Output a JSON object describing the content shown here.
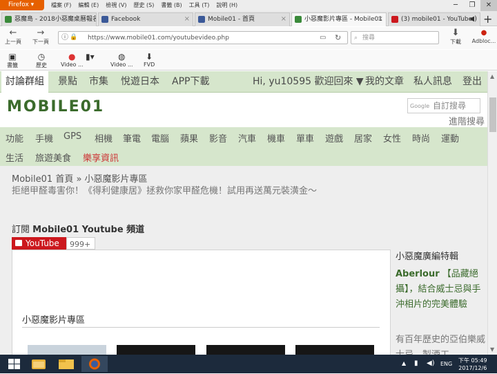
{
  "browser": {
    "app_button": "Firefox",
    "menu": [
      "檔案 (F)",
      "編輯 (E)",
      "檢視 (V)",
      "歷史 (S)",
      "書籤 (B)",
      "工具 (T)",
      "說明 (H)"
    ],
    "tabs": [
      {
        "label": "惡魔島 - 2018小惡魔桌曆報名",
        "icon_color": "#3a8a3a"
      },
      {
        "label": "Facebook",
        "icon_color": "#3b5998"
      },
      {
        "label": "Mobile01 - 首頁",
        "icon_color": "#3b5998"
      },
      {
        "label": "小惡魔影片專區 - Mobile01",
        "icon_color": "#3a8a3a"
      },
      {
        "label": "(3) mobile01 - YouTube",
        "icon_color": "#cc181e"
      }
    ],
    "nav": {
      "back": "上一頁",
      "forward": "下一頁"
    },
    "url": "https://www.mobile01.com/youtubevideo.php",
    "search_placeholder": "搜尋",
    "download_label": "下載",
    "adblock_label": "Adbloc...",
    "bookmarks": [
      {
        "label": "書籤",
        "icon": "bookmark-icon"
      },
      {
        "label": "歷史",
        "icon": "history-icon"
      },
      {
        "label": "Video ...",
        "icon": "video-icon"
      },
      {
        "label": "Video ...",
        "icon": "video-icon"
      },
      {
        "label": "FVD",
        "icon": "download-icon"
      }
    ]
  },
  "site": {
    "top_nav": [
      "討論群組",
      "景點",
      "市集",
      "悅遊日本",
      "APP下載"
    ],
    "user_greeting": "Hi, yu10595 歡迎回來 ▼",
    "user_links": [
      "我的文章",
      "私人訊息",
      "登出"
    ],
    "logo": "MOBILE01",
    "search_placeholder": "自訂搜尋",
    "search_brand": "Google",
    "advanced_search": "進階搜尋",
    "categories_row1": [
      "功能",
      "手機",
      "GPS",
      "相機",
      "筆電",
      "電腦",
      "蘋果",
      "影音",
      "汽車",
      "機車",
      "單車",
      "遊戲",
      "居家",
      "女性",
      "時尚",
      "運動"
    ],
    "categories_row2": [
      "生活",
      "旅遊美食",
      "樂享資訊"
    ],
    "breadcrumb": "Mobile01 首頁 » 小惡魔影片專區",
    "promo": "拒絕甲醛毒害你！《得利健康居》拯救你家甲醛危機！試用再送萬元裝潢金～",
    "subscribe_prefix": "訂閱 ",
    "subscribe_bold": "Mobile01 Youtube 頻道",
    "youtube_label": "YouTube",
    "youtube_count": "999+",
    "video_section_title": "小惡魔影片專區",
    "sidebar": {
      "heading": "小惡魔廣編特輯",
      "article_bold": "Aberlour",
      "article_title": "【品藏絕攝】，結合威士忌與手沖相片的完美體驗",
      "desc": "有百年歷史的亞伯樂威士忌，製酒工"
    }
  },
  "taskbar": {
    "lang": "ENG",
    "time": "下午 05:49",
    "date": "2017/12/6"
  },
  "colors": {
    "firefox_orange": "#e66000",
    "nav_green": "#d6e6cc",
    "brand_green": "#3b6b2c",
    "promo_red": "#cc3333",
    "youtube_red": "#cc181e"
  }
}
